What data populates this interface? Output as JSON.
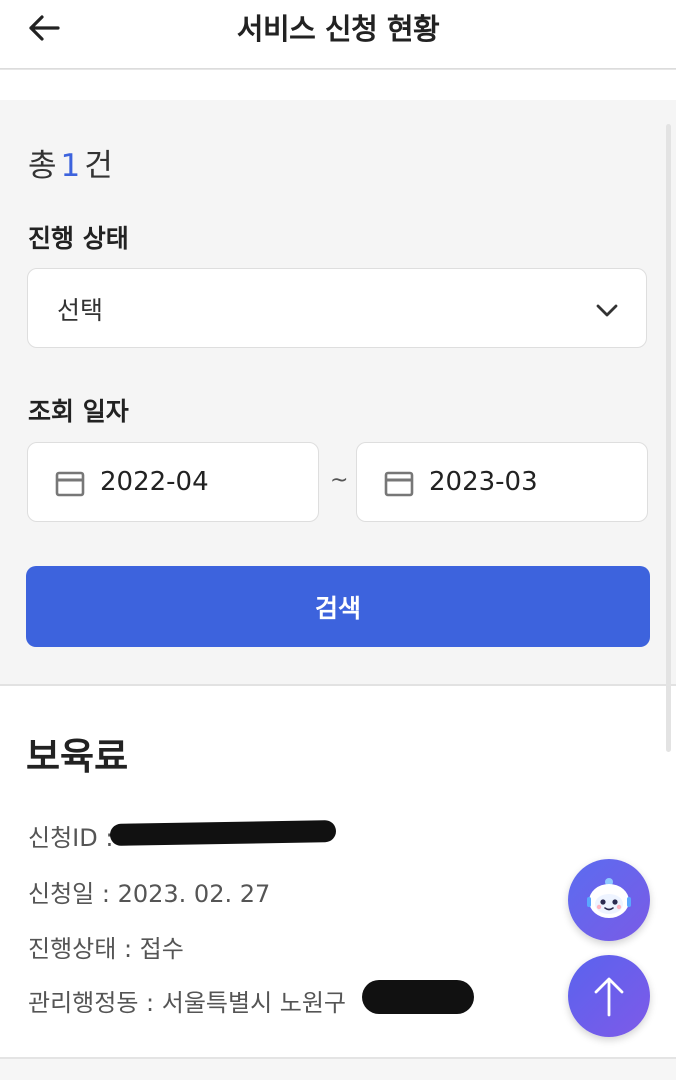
{
  "header": {
    "title": "서비스 신청 현황",
    "back_icon": "arrow-left-icon"
  },
  "filter": {
    "total_prefix": "총",
    "total_count": "1",
    "total_suffix": "건",
    "status_label": "진행 상태",
    "status_select_value": "선택",
    "date_label": "조회 일자",
    "date_from": "2022-04",
    "date_separator": "~",
    "date_to": "2023-03",
    "search_button": "검색"
  },
  "result": {
    "title": "보육료",
    "rows": {
      "application_id_label": "신청ID :",
      "application_date": "신청일 : 2023. 02. 27",
      "status": "진행상태 : 접수",
      "admin_dong_label": "관리행정동 : 서울특별시 노원구"
    }
  },
  "fabs": {
    "chat_icon": "chatbot-icon",
    "top_icon": "arrow-up-icon"
  },
  "colors": {
    "accent": "#3d63dd",
    "panel_bg": "#f5f5f5",
    "fab": "#6a60ec"
  }
}
